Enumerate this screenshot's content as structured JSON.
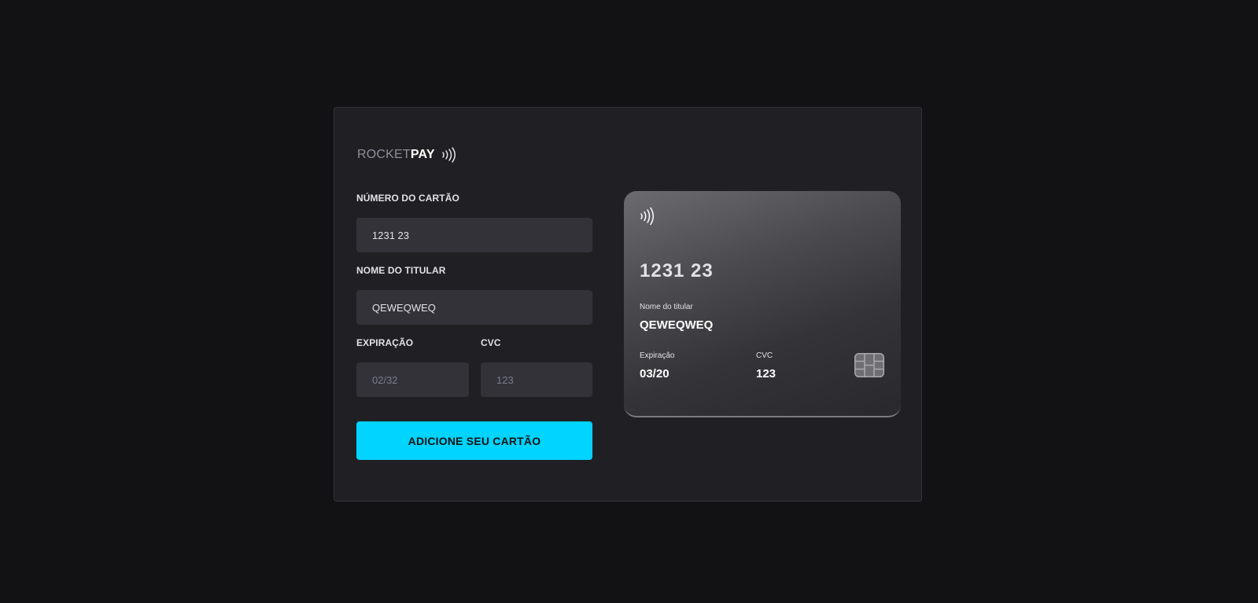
{
  "brand": {
    "name_light": "ROCKET",
    "name_bold": "PAY",
    "icon": "contactless-icon"
  },
  "form": {
    "card_number": {
      "label": "NÚMERO DO CARTÃO",
      "value": "1231 23"
    },
    "holder_name": {
      "label": "NOME DO TITULAR",
      "value": "QEWEQWEQ"
    },
    "expiration": {
      "label": "EXPIRAÇÃO",
      "value": "",
      "placeholder": "02/32"
    },
    "cvc": {
      "label": "CVC",
      "value": "",
      "placeholder": "123"
    },
    "submit_label": "ADICIONE SEU CARTÃO"
  },
  "card_preview": {
    "icon": "contactless-icon",
    "number": "1231 23",
    "holder_label": "Nome do titular",
    "holder_value": "QEWEQWEQ",
    "expiration_label": "Expiração",
    "expiration_value": "03/20",
    "cvc_label": "CVC",
    "cvc_value": "123",
    "chip_icon": "card-chip-icon"
  },
  "colors": {
    "background": "#121214",
    "panel": "#202024",
    "input": "#323238",
    "accent": "#00d4ff"
  }
}
